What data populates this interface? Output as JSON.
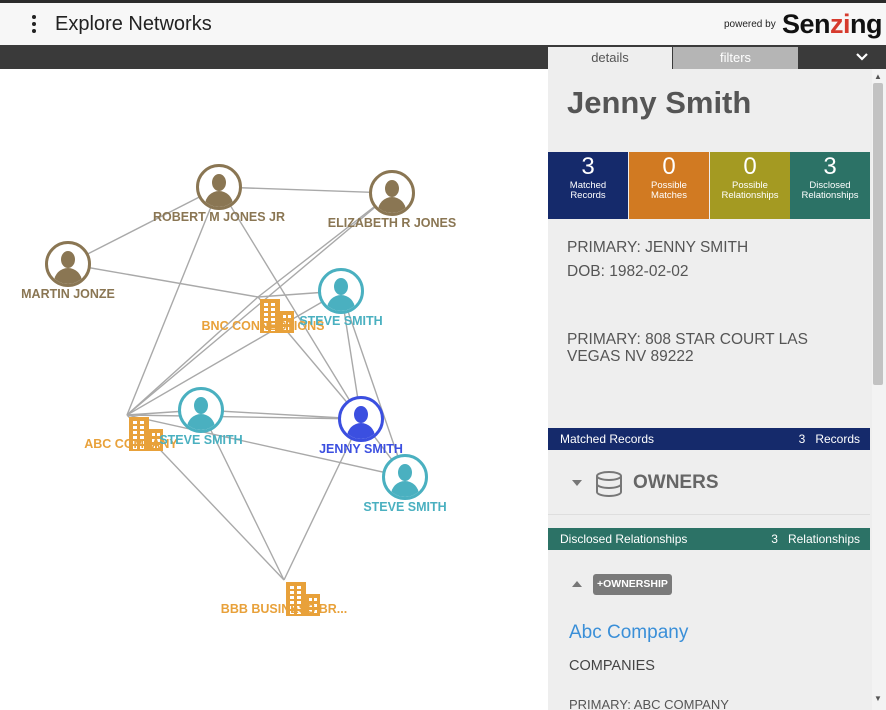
{
  "header": {
    "title": "Explore Networks",
    "powered_by": "powered by",
    "logo_part1": "Sen",
    "logo_part2": "zi",
    "logo_part3": "ng"
  },
  "tabs": {
    "details": "details",
    "filters": "filters"
  },
  "graph": {
    "nodes": [
      {
        "id": "robert",
        "label": "ROBERT M JONES JR",
        "kind": "person",
        "color": "#8a7653"
      },
      {
        "id": "elizabeth",
        "label": "ELIZABETH R JONES",
        "kind": "person",
        "color": "#8a7653"
      },
      {
        "id": "martin",
        "label": "MARTIN JONZE",
        "kind": "person",
        "color": "#8a7653"
      },
      {
        "id": "bnc",
        "label": "BNC CONNECTIONS",
        "kind": "company",
        "color": "#e8a13a"
      },
      {
        "id": "steve1",
        "label": "STEVE SMITH",
        "kind": "person",
        "color": "#4ab0c0"
      },
      {
        "id": "abc",
        "label": "ABC COMPANY",
        "kind": "company",
        "color": "#e8a13a"
      },
      {
        "id": "steve2",
        "label": "STEVE SMITH",
        "kind": "person",
        "color": "#4ab0c0"
      },
      {
        "id": "jenny",
        "label": "JENNY SMITH",
        "kind": "person",
        "color": "#3b4fe0"
      },
      {
        "id": "steve3",
        "label": "STEVE SMITH",
        "kind": "person",
        "color": "#4ab0c0"
      },
      {
        "id": "bbb",
        "label": "BBB BUSINESS BR...",
        "kind": "company",
        "color": "#e8a13a"
      }
    ],
    "edges": [
      [
        "robert",
        "elizabeth"
      ],
      [
        "robert",
        "martin"
      ],
      [
        "robert",
        "abc"
      ],
      [
        "robert",
        "jenny"
      ],
      [
        "elizabeth",
        "bnc"
      ],
      [
        "elizabeth",
        "abc"
      ],
      [
        "martin",
        "bnc"
      ],
      [
        "bnc",
        "abc"
      ],
      [
        "bnc",
        "jenny"
      ],
      [
        "bnc",
        "steve1"
      ],
      [
        "steve1",
        "abc"
      ],
      [
        "steve1",
        "steve3"
      ],
      [
        "steve1",
        "jenny"
      ],
      [
        "abc",
        "steve2"
      ],
      [
        "abc",
        "jenny"
      ],
      [
        "abc",
        "bbb"
      ],
      [
        "abc",
        "steve3"
      ],
      [
        "steve2",
        "jenny"
      ],
      [
        "steve2",
        "bbb"
      ],
      [
        "jenny",
        "steve3"
      ],
      [
        "jenny",
        "bbb"
      ]
    ]
  },
  "details": {
    "entity_name": "Jenny Smith",
    "stats": [
      {
        "num": "3",
        "label": "Matched Records",
        "color": "#152a6b"
      },
      {
        "num": "0",
        "label": "Possible Matches",
        "color": "#d17a22"
      },
      {
        "num": "0",
        "label": "Possible Relationships",
        "color": "#a49a22"
      },
      {
        "num": "3",
        "label": "Disclosed Relationships",
        "color": "#2c7266"
      }
    ],
    "primary_name": "PRIMARY: JENNY SMITH",
    "dob": "DOB: 1982-02-02",
    "primary_address": "PRIMARY: 808 STAR COURT LAS VEGAS NV 89222",
    "matched_records": {
      "title": "Matched Records",
      "count": "3",
      "unit": "Records",
      "color": "#152a6b"
    },
    "group_label": "OWNERS",
    "disclosed": {
      "title": "Disclosed Relationships",
      "count": "3",
      "unit": "Relationships",
      "color": "#2c7266"
    },
    "tag": "+OWNERSHIP",
    "rel_name": "Abc Company",
    "rel_type": "COMPANIES",
    "rel_primary": "PRIMARY: ABC COMPANY"
  }
}
